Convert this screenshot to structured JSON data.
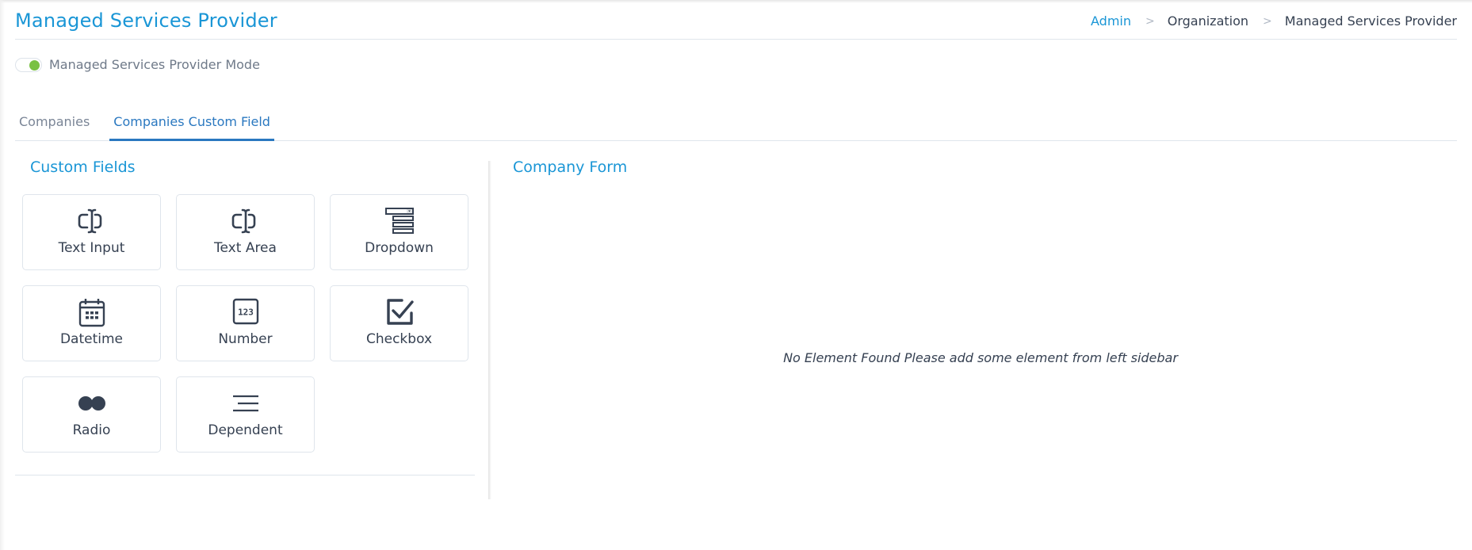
{
  "header": {
    "title": "Managed Services Provider",
    "breadcrumb": [
      {
        "label": "Admin",
        "link": true
      },
      {
        "label": "Organization",
        "link": false
      },
      {
        "label": "Managed Services Provider",
        "link": false
      }
    ],
    "breadcrumb_separator": ">"
  },
  "msp_mode": {
    "label": "Managed Services Provider Mode",
    "enabled": true,
    "toggle_color": "#7ac143"
  },
  "tabs": [
    {
      "label": "Companies",
      "active": false
    },
    {
      "label": "Companies Custom Field",
      "active": true
    }
  ],
  "custom_fields": {
    "title": "Custom Fields",
    "items": [
      {
        "label": "Text Input",
        "icon": "text-input-icon"
      },
      {
        "label": "Text Area",
        "icon": "text-area-icon"
      },
      {
        "label": "Dropdown",
        "icon": "dropdown-icon"
      },
      {
        "label": "Datetime",
        "icon": "calendar-icon"
      },
      {
        "label": "Number",
        "icon": "number-icon",
        "icon_text": "123"
      },
      {
        "label": "Checkbox",
        "icon": "checkbox-icon"
      },
      {
        "label": "Radio",
        "icon": "radio-icon"
      },
      {
        "label": "Dependent",
        "icon": "dependent-icon"
      }
    ]
  },
  "company_form": {
    "title": "Company Form",
    "empty_message": "No Element Found Please add some element from left sidebar"
  },
  "colors": {
    "accent": "#1a96d6",
    "tab_active": "#2a78c0",
    "icon": "#364152"
  }
}
